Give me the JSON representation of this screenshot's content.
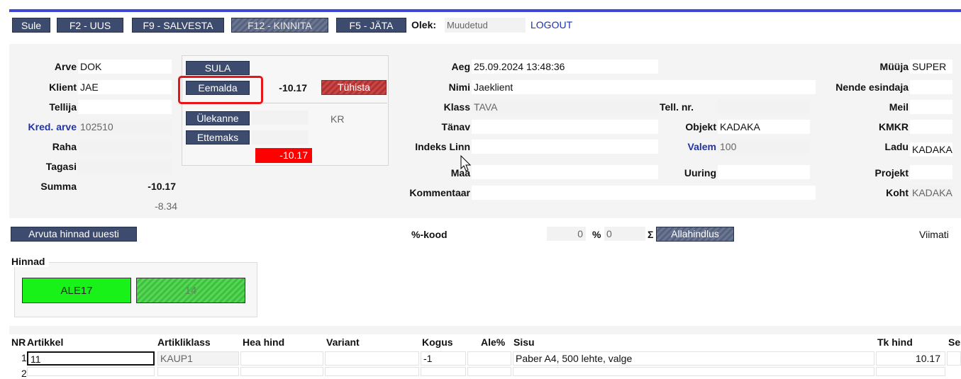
{
  "toolbar": {
    "close_label": "Sule",
    "new_label": "F2 - UUS",
    "save_label": "F9 - SALVESTA",
    "confirm_label": "F12 - KINNITA",
    "cancel_label": "F5 - JÄTA",
    "status_label": "Olek:",
    "status_value": "Muudetud",
    "logout_label": "LOGOUT"
  },
  "invoice": {
    "arve_label": "Arve",
    "arve_value": "DOK",
    "klient_label": "Klient",
    "klient_value": "JAE",
    "tellija_label": "Tellija",
    "tellija_value": "",
    "kred_label": "Kred. arve",
    "kred_value": "102510",
    "raha_label": "Raha",
    "raha_value": "",
    "tagasi_label": "Tagasi",
    "tagasi_value": "",
    "summa_label": "Summa",
    "summa_value": "-10.17",
    "summa_sub": "-8.34"
  },
  "payment": {
    "sula_label": "SULA",
    "eemalda_label": "Eemalda",
    "eemalda_amount": "-10.17",
    "tuhista_label": "Tühista",
    "ulekanne_label": "Ülekanne",
    "ulekanne_note": "KR",
    "ettemaks_label": "Ettemaks",
    "balance": "-10.17"
  },
  "details": {
    "aeg_label": "Aeg",
    "aeg_value": "25.09.2024 13:48:36",
    "nimi_label": "Nimi",
    "nimi_value": "Jaeklient",
    "klass_label": "Klass",
    "klass_value": "TAVA",
    "tanav_label": "Tänav",
    "tanav_value": "",
    "indeks_label": "Indeks Linn",
    "indeks_value": "",
    "maa_label": "Maa",
    "maa_value": "",
    "kommentaar_label": "Kommentaar",
    "kommentaar_value": "",
    "tell_label": "Tell. nr.",
    "tell_value": "",
    "objekt_label": "Objekt",
    "objekt_value": "KADAKA",
    "valem_label": "Valem",
    "valem_value": "100",
    "uuring_label": "Uuring",
    "uuring_value": ""
  },
  "right": {
    "muuja_label": "Müüja",
    "muuja_value": "SUPER",
    "nende_label": "Nende esindaja",
    "meil_label": "Meil",
    "kmkr_label": "KMKR",
    "ladu_label": "Ladu",
    "ladu_value": "KADAKA",
    "projekt_label": "Projekt",
    "koht_label": "Koht",
    "koht_value": "KADAKA"
  },
  "pricing": {
    "recalc_label": "Arvuta hinnad uuesti",
    "kood_label": "%-kood",
    "kood_value": "",
    "kood_num": "0",
    "pct_label": "%",
    "pct_value": "0",
    "sigma": "Σ",
    "allahindlus_label": "Allahindlus",
    "viimati_label": "Viimati"
  },
  "hinnad": {
    "title": "Hinnad",
    "price1": "ALE17",
    "price2": "14"
  },
  "grid": {
    "headers": [
      "NR",
      "Artikkel",
      "Artikliklass",
      "Hea hind",
      "Variant",
      "Kogus",
      "Ale%",
      "Sisu",
      "Tk hind",
      "Se"
    ],
    "row1": {
      "nr": "1",
      "artikkel": "11",
      "klass": "KAUP1",
      "kogus": "-1",
      "sisu": "Paber A4, 500 lehte, valge",
      "tkhind": "10.17"
    },
    "row2_nr": "2"
  },
  "colors": {
    "button": "#3c4b6e",
    "accent_line": "#3a48d8",
    "highlight": "#e8141a",
    "negative_bg": "#ff0000",
    "price_green": "#19f219"
  }
}
